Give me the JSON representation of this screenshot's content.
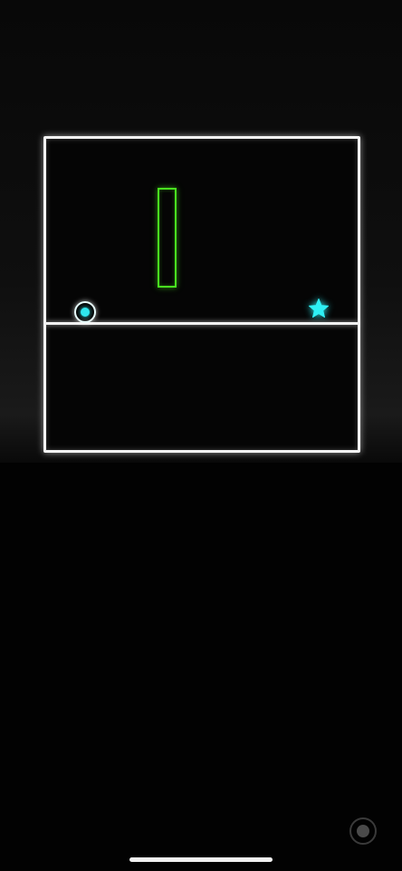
{
  "game": {
    "arena": {
      "border_color": "#f4f4f4"
    },
    "floor": {
      "color": "#f0f0f0"
    },
    "obstacle": {
      "shape": "rectangle",
      "color": "#49e01f"
    },
    "player": {
      "shape": "ring-with-dot",
      "ring_color": "#e8ffff",
      "core_color": "#2fe6ee"
    },
    "goal": {
      "icon": "star-icon",
      "color": "#2ef0f5"
    }
  },
  "system": {
    "record_button": {
      "icon": "record-icon"
    },
    "home_indicator": {
      "color": "#f2f2f2"
    }
  },
  "colors": {
    "background": "#000000",
    "accent_green": "#49e01f",
    "accent_cyan": "#2fe6ee"
  }
}
